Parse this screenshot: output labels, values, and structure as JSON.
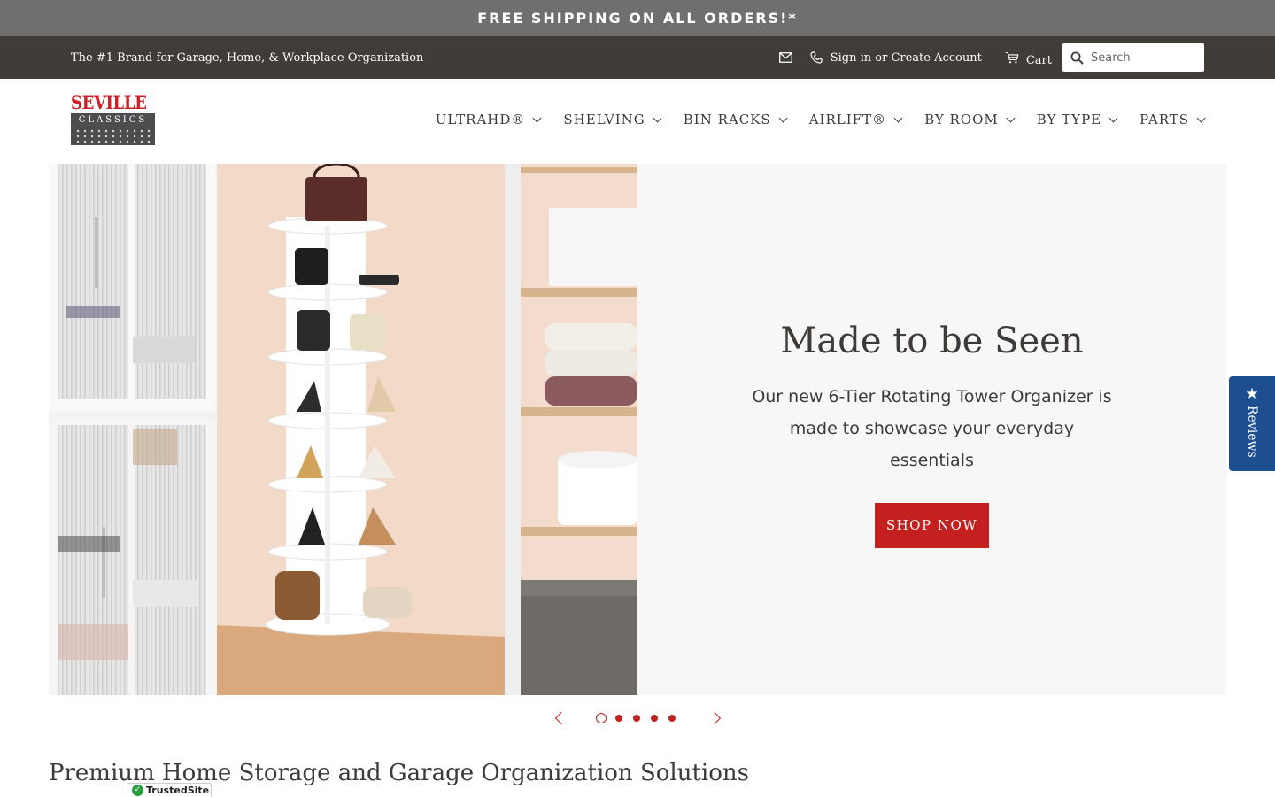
{
  "announcement": {
    "text": "FREE SHIPPING ON ALL ORDERS!*"
  },
  "utility": {
    "tagline": "The #1 Brand for Garage, Home, & Workplace Organization",
    "signin_label": "Sign in or Create Account",
    "cart_label": "Cart",
    "search_placeholder": "Search"
  },
  "logo": {
    "top": "SEVILLE",
    "bottom": "CLASSICS",
    "alt": "Seville Classics"
  },
  "nav": {
    "items": [
      {
        "label": "ULTRAHD®"
      },
      {
        "label": "SHELVING"
      },
      {
        "label": "BIN RACKS"
      },
      {
        "label": "AIRLIFT®"
      },
      {
        "label": "BY ROOM"
      },
      {
        "label": "BY TYPE"
      },
      {
        "label": "PARTS"
      }
    ]
  },
  "hero": {
    "title": "Made to be Seen",
    "subtitle": "Our new 6-Tier Rotating Tower Organizer is made to showcase your everyday essentials",
    "cta": "SHOP NOW"
  },
  "slider": {
    "total": 5,
    "active": 1
  },
  "section": {
    "title": "Premium Home Storage and Garage Organization Solutions"
  },
  "reviews_tab": {
    "label": "Reviews"
  },
  "trusted_badge": {
    "label": "TrustedSite"
  },
  "colors": {
    "brand_red": "#c4201f",
    "header_dark": "#403c37",
    "announce_gray": "#6f6f6f",
    "reviews_blue": "#1d4e8f"
  }
}
